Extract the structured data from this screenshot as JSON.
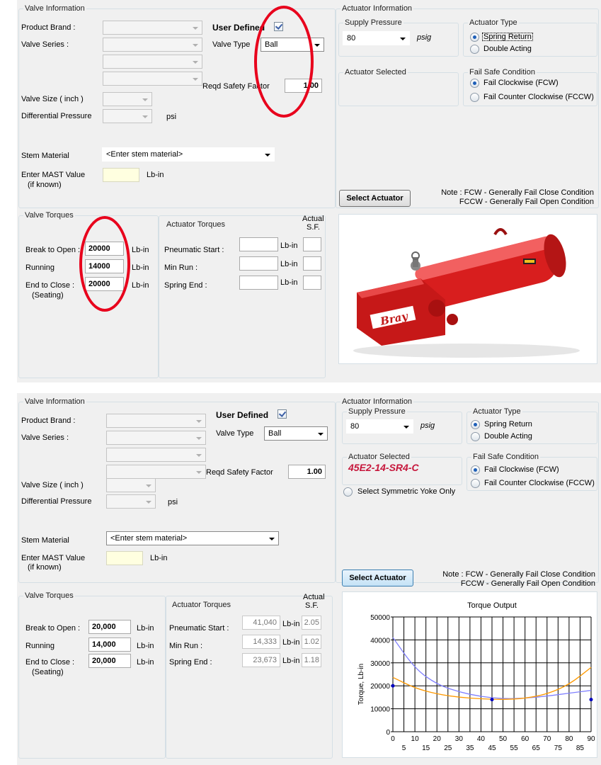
{
  "valve_info_title": "Valve Information",
  "actuator_info_title": "Actuator Information",
  "labels": {
    "product_brand": "Product Brand :",
    "valve_series": "Valve Series  :",
    "valve_size": "Valve Size ( inch )",
    "diff_pressure": "Differential Pressure",
    "psi": "psi",
    "user_defined": "User Defined",
    "valve_type": "Valve Type",
    "reqd_safety_factor": "Reqd Safety Factor",
    "stem_material": "Stem Material",
    "mast_value": "Enter MAST Value",
    "if_known": "(if known)",
    "lbin": "Lb-in",
    "supply_pressure": "Supply Pressure",
    "psig": "psig",
    "actuator_type": "Actuator Type",
    "spring_return": "Spring Return",
    "double_acting": "Double Acting",
    "actuator_selected": "Actuator Selected",
    "fail_safe": "Fail Safe Condition",
    "fcw": "Fail Clockwise (FCW)",
    "fccw": "Fail Counter Clockwise (FCCW)",
    "select_actuator": "Select Actuator",
    "note_line1": "Note : FCW  - Generally Fail Close Condition",
    "note_line2": "FCCW - Generally Fail Open Condition",
    "valve_torques": "Valve Torques",
    "actuator_torques": "Actuator Torques",
    "actual": "Actual",
    "sf": "S.F.",
    "break_to_open": "Break to Open :",
    "running": "Running",
    "end_to_close": "End to Close :",
    "seating": "(Seating)",
    "pneumatic_start": "Pneumatic Start :",
    "min_run": "Min Run  :",
    "spring_end": "Spring End    :",
    "symmetric_yoke": "Select Symmetric Yoke Only"
  },
  "top": {
    "valve_type": "Ball",
    "safety_factor": "1.00",
    "stem_material": "<Enter stem material>",
    "supply_pressure": "80",
    "break_to_open": "20000",
    "running": "14000",
    "end_to_close": "20000",
    "brand_logo": "Bray"
  },
  "bottom": {
    "valve_type": "Ball",
    "safety_factor": "1.00",
    "stem_material": "<Enter stem material>",
    "supply_pressure": "80",
    "actuator_selected": "45E2-14-SR4-C",
    "break_to_open": "20,000",
    "running": "14,000",
    "end_to_close": "20,000",
    "pneumatic_start": "41,040",
    "min_run": "14,333",
    "spring_end": "23,673",
    "sf_start": "2.05",
    "sf_run": "1.02",
    "sf_end": "1.18"
  },
  "chart_data": {
    "type": "line",
    "title": "Torque Output",
    "ylabel": "Torque, Lb-in",
    "xlabel": "",
    "xlim": [
      0,
      90
    ],
    "ylim": [
      0,
      50000
    ],
    "x_ticks_top_row": [
      "0",
      "10",
      "20",
      "30",
      "40",
      "50",
      "60",
      "70",
      "80",
      "90"
    ],
    "x_ticks_bottom_row": [
      "5",
      "15",
      "25",
      "35",
      "45",
      "55",
      "65",
      "75",
      "85"
    ],
    "y_ticks": [
      "0",
      "10000",
      "20000",
      "30000",
      "40000",
      "50000"
    ],
    "grid": true,
    "series": [
      {
        "color": "#8080ff",
        "x": [
          0,
          10,
          20,
          30,
          40,
          50,
          60,
          70,
          80,
          90
        ],
        "values": [
          41040,
          27500,
          20600,
          17300,
          15300,
          14333,
          14600,
          15500,
          16800,
          18000
        ]
      },
      {
        "color": "#ff9900",
        "x": [
          0,
          10,
          20,
          30,
          40,
          50,
          60,
          70,
          80,
          90
        ],
        "values": [
          23673,
          19000,
          16400,
          15000,
          14300,
          14000,
          14500,
          16400,
          20500,
          28000
        ]
      }
    ],
    "markers": [
      {
        "x": 45,
        "y": 14000,
        "color": "#0000c0"
      },
      {
        "x": 90,
        "y": 14000,
        "color": "#0000c0"
      },
      {
        "x": 0,
        "y": 20000,
        "color": "#0000c0"
      }
    ]
  },
  "colors": {
    "highlight_ellipse": "#e8001c",
    "actuator_red": "#d81e1e",
    "selected_text": "#c6163b"
  }
}
